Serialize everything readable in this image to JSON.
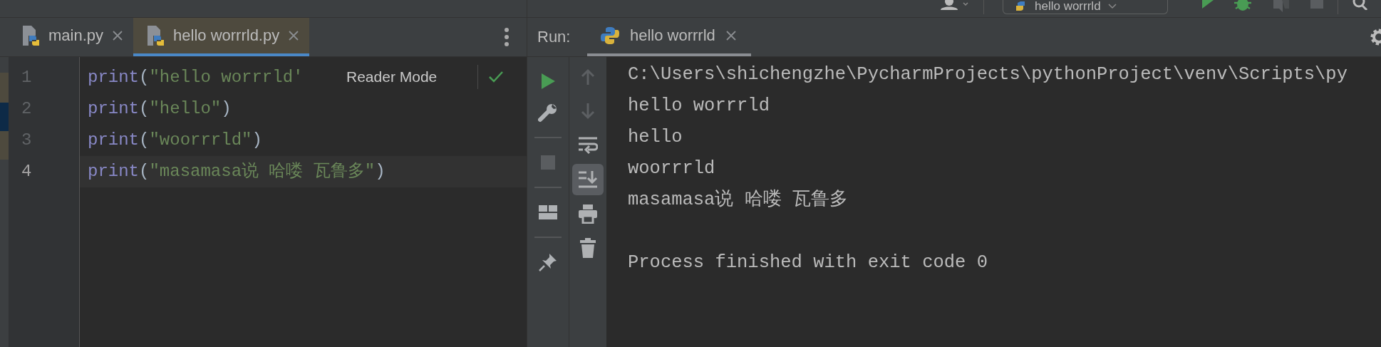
{
  "toolbar": {
    "run_config": "hello worrrld"
  },
  "editor": {
    "tabs": [
      {
        "label": "main.py",
        "selected": false
      },
      {
        "label": "hello worrrld.py",
        "selected": true
      }
    ],
    "lines": [
      {
        "number": "1",
        "code": "print(\"hello worrrld'",
        "current": false
      },
      {
        "number": "2",
        "code": "print(\"hello\")",
        "current": false
      },
      {
        "number": "3",
        "code": "print(\"woorrrld\")",
        "current": false
      },
      {
        "number": "4",
        "code": "print(\"masamasa说 哈喽 瓦鲁多\")",
        "current": true
      }
    ],
    "reader_mode": "Reader Mode"
  },
  "run": {
    "label": "Run:",
    "tabs": [
      {
        "label": "hello worrrld",
        "selected": true
      }
    ],
    "side_actions": [
      {
        "kind": "rerun",
        "disabled": false
      },
      {
        "kind": "wrench",
        "disabled": false
      },
      {
        "kind": "stop",
        "disabled": true
      },
      {
        "kind": "layout",
        "disabled": false
      },
      {
        "kind": "pin",
        "disabled": false
      }
    ],
    "console_actions": [
      {
        "kind": "up",
        "disabled": true,
        "on": false
      },
      {
        "kind": "down",
        "disabled": true,
        "on": false
      },
      {
        "kind": "wrap",
        "disabled": false,
        "on": false
      },
      {
        "kind": "scroll",
        "disabled": false,
        "on": true
      },
      {
        "kind": "print",
        "disabled": false,
        "on": false
      },
      {
        "kind": "trash",
        "disabled": false,
        "on": false
      }
    ],
    "console": [
      "C:\\Users\\shichengzhe\\PycharmProjects\\pythonProject\\venv\\Scripts\\py",
      "hello worrrld",
      "hello",
      "woorrrld",
      "masamasa说 哈喽 瓦鲁多"
    ],
    "exit_message": "Process finished with exit code 0"
  }
}
